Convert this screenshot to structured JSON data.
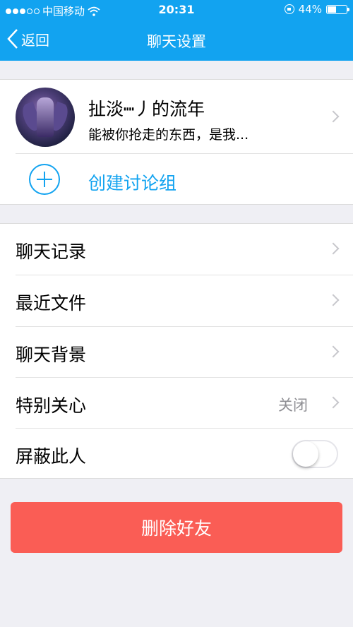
{
  "status_bar": {
    "carrier": "中国移动",
    "time": "20:31",
    "battery_percent": "44%",
    "battery_level": 0.44
  },
  "nav": {
    "back_label": "返回",
    "title": "聊天设置"
  },
  "profile": {
    "name": "扯淡┉丿的流年",
    "signature": "能被你抢走的东西，是我..."
  },
  "create_group_label": "创建讨论组",
  "settings": [
    {
      "label": "聊天记录"
    },
    {
      "label": "最近文件"
    },
    {
      "label": "聊天背景"
    },
    {
      "label": "特别关心",
      "value": "关闭"
    },
    {
      "label": "屏蔽此人",
      "toggle": false
    }
  ],
  "delete_button_label": "删除好友",
  "colors": {
    "accent": "#12a3f0",
    "danger": "#fa5d55",
    "background": "#efeff4"
  }
}
